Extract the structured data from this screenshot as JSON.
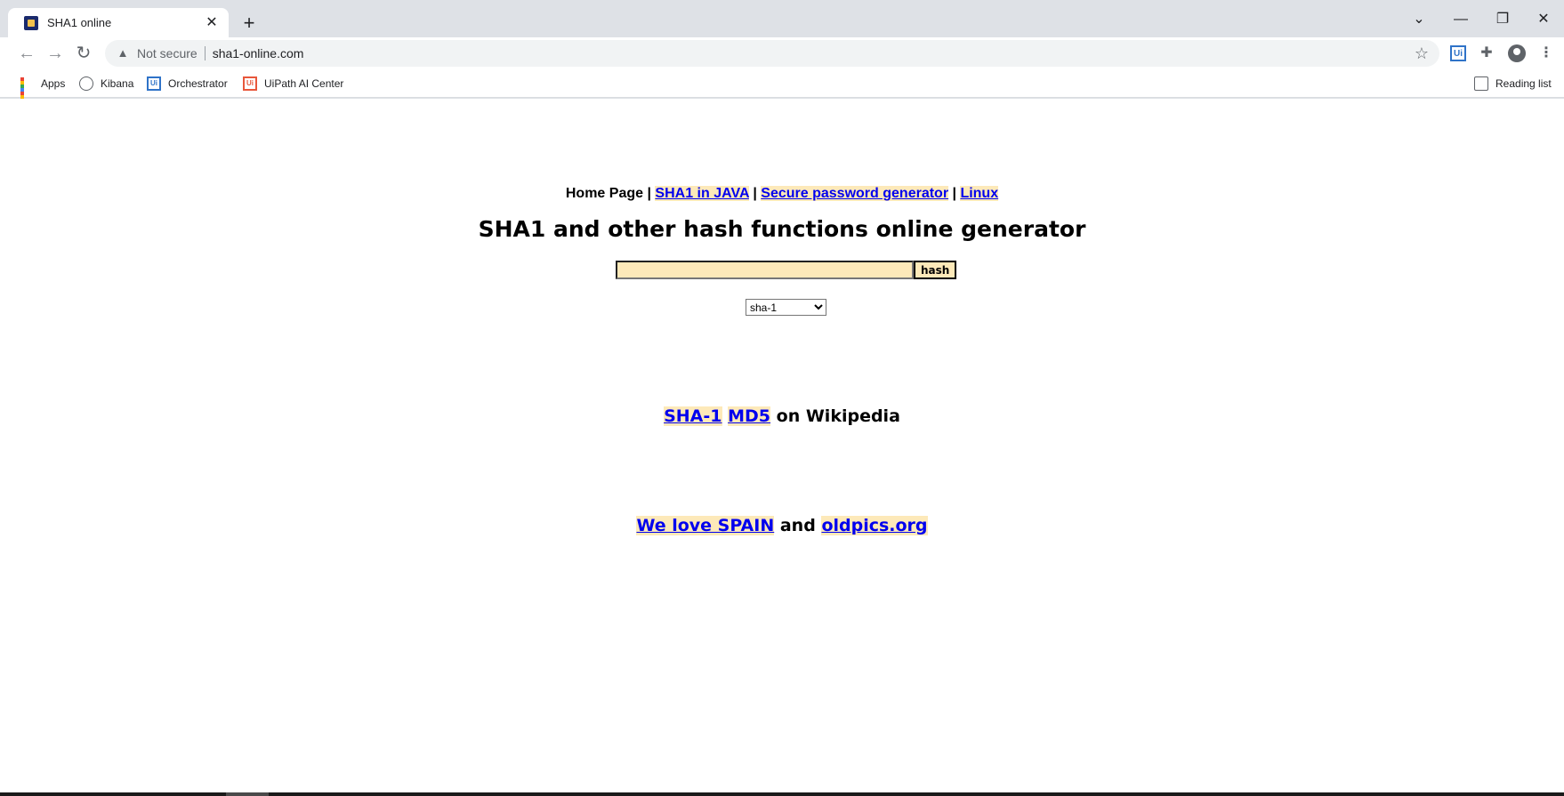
{
  "browser": {
    "tab": {
      "title": "SHA1 online",
      "close_glyph": "✕"
    },
    "new_tab_glyph": "+",
    "window_controls": {
      "tabsearch": "⌄",
      "minimize": "—",
      "restore": "❐",
      "close": "✕"
    },
    "omnibox": {
      "security_label": "Not secure",
      "url": "sha1-online.com"
    },
    "bookmarks": [
      {
        "label": "Apps",
        "icon": "apps-grid-icon"
      },
      {
        "label": "Kibana",
        "icon": "kibana-icon"
      },
      {
        "label": "Orchestrator",
        "icon": "uipath-icon"
      },
      {
        "label": "UiPath AI Center",
        "icon": "uipath-ai-center-icon"
      }
    ],
    "reading_list": "Reading list",
    "accent_color": "#1a73e8"
  },
  "page": {
    "nav": {
      "home": "Home Page",
      "sep": "|",
      "links": [
        "SHA1 in JAVA",
        "Secure password generator",
        "Linux"
      ]
    },
    "title": "SHA1 and other hash functions online generator",
    "form": {
      "input_value": "",
      "button_label": "hash",
      "selected_algorithm": "sha-1"
    },
    "wiki": {
      "link1": "SHA-1",
      "link2": "MD5",
      "suffix": "on Wikipedia"
    },
    "promo": {
      "link1": "We love SPAIN",
      "middle": "and",
      "link2": "oldpics.org"
    },
    "link_highlight_color": "#fde9b9",
    "link_color": "#0000ee"
  }
}
